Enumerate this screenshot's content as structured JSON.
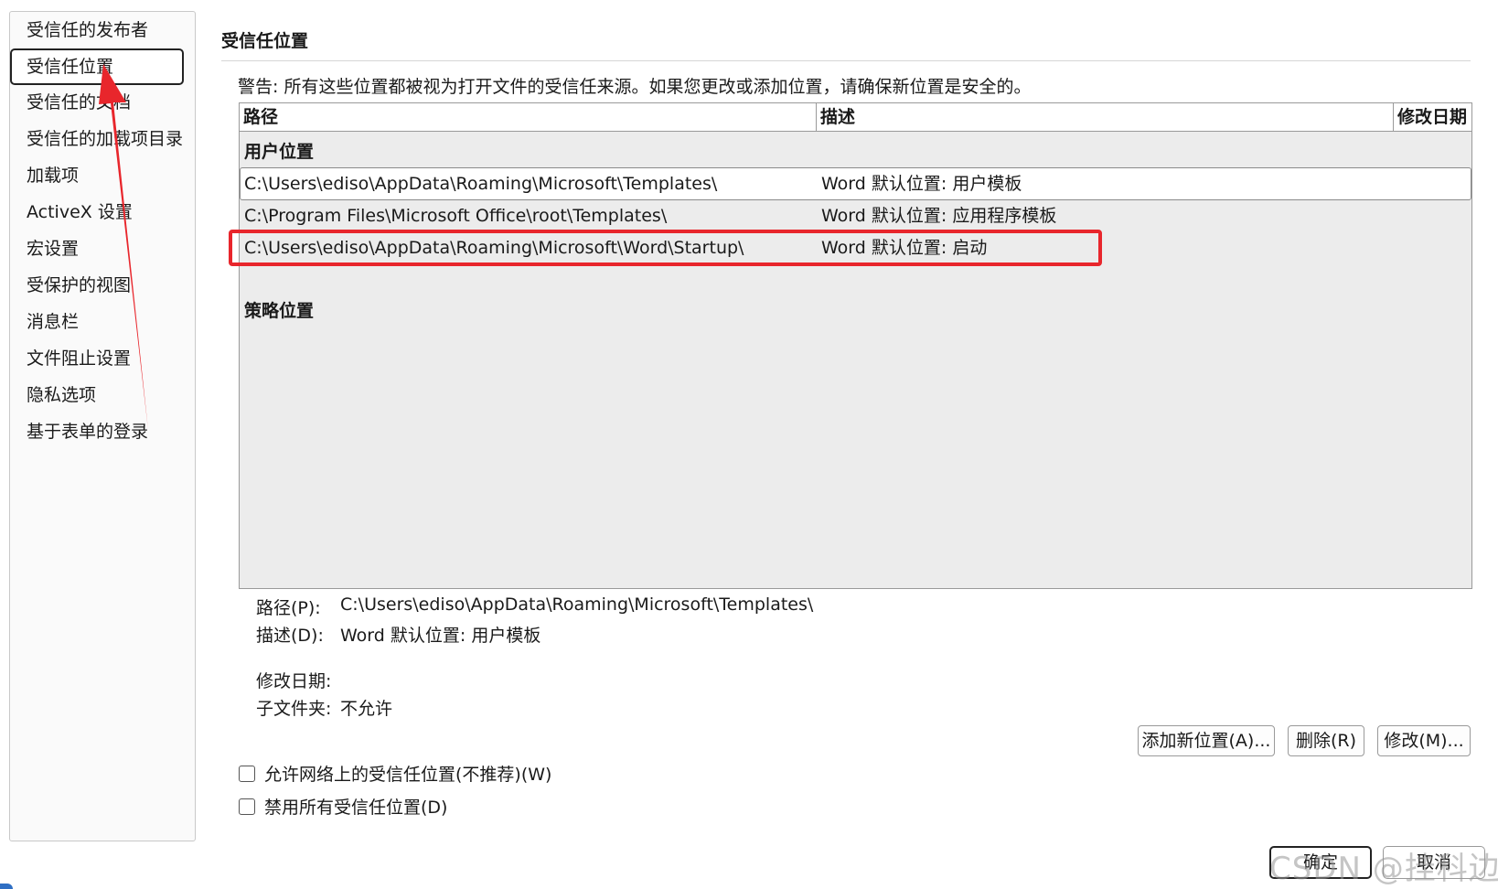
{
  "sidebar": {
    "items": [
      {
        "label": "受信任的发布者"
      },
      {
        "label": "受信任位置"
      },
      {
        "label": "受信任的文档"
      },
      {
        "label": "受信任的加载项目录"
      },
      {
        "label": "加载项"
      },
      {
        "label": "ActiveX 设置"
      },
      {
        "label": "宏设置"
      },
      {
        "label": "受保护的视图"
      },
      {
        "label": "消息栏"
      },
      {
        "label": "文件阻止设置"
      },
      {
        "label": "隐私选项"
      },
      {
        "label": "基于表单的登录"
      }
    ],
    "selected_index": 1
  },
  "main": {
    "title": "受信任位置",
    "warning": "警告: 所有这些位置都被视为打开文件的受信任来源。如果您更改或添加位置，请确保新位置是安全的。",
    "table": {
      "headers": {
        "path": "路径",
        "description": "描述",
        "modified": "修改日期"
      },
      "user_group": "用户位置",
      "rows": [
        {
          "path": "C:\\Users\\ediso\\AppData\\Roaming\\Microsoft\\Templates\\",
          "description": "Word 默认位置: 用户模板"
        },
        {
          "path": "C:\\Program Files\\Microsoft Office\\root\\Templates\\",
          "description": "Word 默认位置: 应用程序模板"
        },
        {
          "path": "C:\\Users\\ediso\\AppData\\Roaming\\Microsoft\\Word\\Startup\\",
          "description": "Word 默认位置: 启动"
        }
      ],
      "policy_group": "策略位置"
    },
    "details": {
      "path_label": "路径(P):",
      "path_value": "C:\\Users\\ediso\\AppData\\Roaming\\Microsoft\\Templates\\",
      "desc_label": "描述(D):",
      "desc_value": "Word 默认位置: 用户模板",
      "modified_label": "修改日期:",
      "subfolder_label": "子文件夹:",
      "subfolder_value": "不允许"
    },
    "buttons": {
      "add": "添加新位置(A)...",
      "remove": "删除(R)",
      "modify": "修改(M)..."
    },
    "checkboxes": {
      "allow_network": "允许网络上的受信任位置(不推荐)(W)",
      "disable_all": "禁用所有受信任位置(D)"
    }
  },
  "footer": {
    "ok": "确定",
    "cancel": "取消"
  },
  "watermark": "CSDN @挂科边缘",
  "colors": {
    "highlight": "#e8262c",
    "arrow": "#e8262c"
  }
}
